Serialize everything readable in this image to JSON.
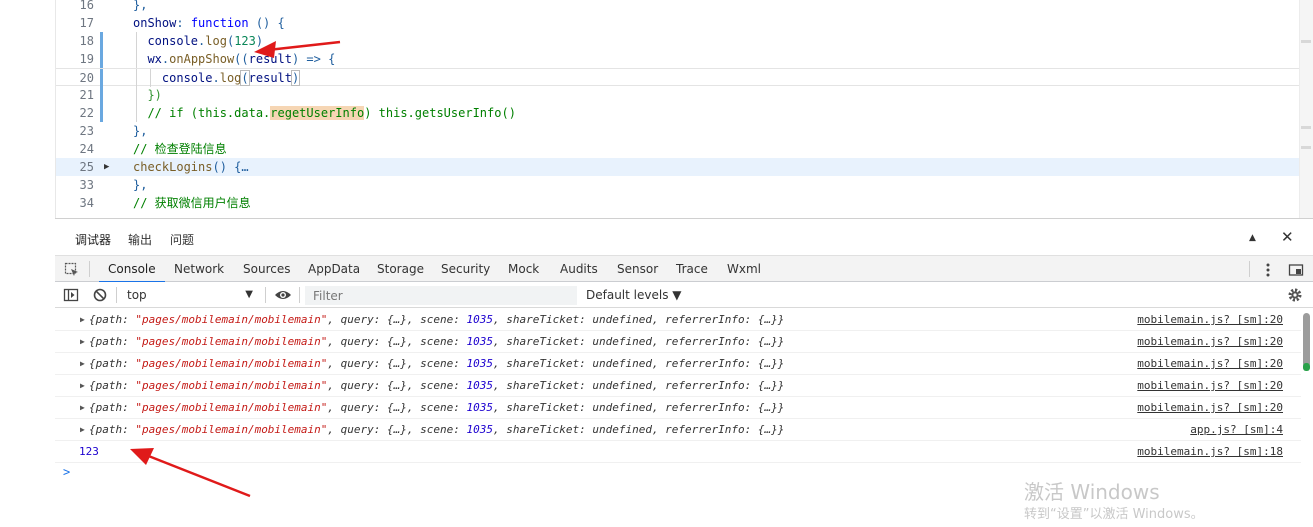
{
  "editor": {
    "lines": [
      {
        "num": "16",
        "tokens": [
          {
            "t": "},",
            "c": "c-plain"
          }
        ]
      },
      {
        "num": "17",
        "tokens": [
          {
            "t": "onShow",
            "c": "c-var"
          },
          {
            "t": ": ",
            "c": "c-plain"
          },
          {
            "t": "function",
            "c": "c-kw"
          },
          {
            "t": " () {",
            "c": "c-plain"
          }
        ]
      },
      {
        "num": "18",
        "tokens": [
          {
            "t": "  console",
            "c": "c-var"
          },
          {
            "t": ".",
            "c": "c-plain"
          },
          {
            "t": "log",
            "c": "c-fn"
          },
          {
            "t": "(",
            "c": "c-plain"
          },
          {
            "t": "123",
            "c": "c-num"
          },
          {
            "t": ")",
            "c": "c-plain"
          }
        ]
      },
      {
        "num": "19",
        "tokens": [
          {
            "t": "  wx",
            "c": "c-var"
          },
          {
            "t": ".",
            "c": "c-plain"
          },
          {
            "t": "onAppShow",
            "c": "c-fn"
          },
          {
            "t": "((",
            "c": "c-plain"
          },
          {
            "t": "result",
            "c": "c-var"
          },
          {
            "t": ") => {",
            "c": "c-plain"
          }
        ]
      },
      {
        "num": "20",
        "tokens": [
          {
            "t": "    console",
            "c": "c-var"
          },
          {
            "t": ".",
            "c": "c-plain"
          },
          {
            "t": "log",
            "c": "c-fn"
          },
          {
            "t": "(",
            "c": "c-plain c-box"
          },
          {
            "t": "result",
            "c": "c-var"
          },
          {
            "t": ")",
            "c": "c-plain c-box"
          }
        ]
      },
      {
        "num": "21",
        "tokens": [
          {
            "t": "  })",
            "c": "c-brk2"
          }
        ]
      },
      {
        "num": "22",
        "tokens": [
          {
            "t": "  // if (this.data.",
            "c": "c-cmt"
          },
          {
            "t": "regetUserInfo",
            "c": "c-cmt c-hl"
          },
          {
            "t": ") this.getsUserInfo()",
            "c": "c-cmt"
          }
        ]
      },
      {
        "num": "23",
        "tokens": [
          {
            "t": "},",
            "c": "c-plain"
          }
        ]
      },
      {
        "num": "24",
        "tokens": [
          {
            "t": "// 检查登陆信息",
            "c": "c-cmt"
          }
        ]
      },
      {
        "num": "25",
        "tokens": [
          {
            "t": "checkLogins",
            "c": "c-fn"
          },
          {
            "t": "() {",
            "c": "c-plain"
          },
          {
            "t": "…",
            "c": "c-plain"
          }
        ]
      },
      {
        "num": "33",
        "tokens": [
          {
            "t": "},",
            "c": "c-plain"
          }
        ]
      },
      {
        "num": "34",
        "tokens": [
          {
            "t": "// 获取微信用户信息",
            "c": "c-cmt"
          }
        ]
      }
    ]
  },
  "panel": {
    "tabs": [
      "调试器",
      "输出",
      "问题"
    ],
    "active_tab": "调试器"
  },
  "devtools": {
    "tabs": [
      "Console",
      "Network",
      "Sources",
      "AppData",
      "Storage",
      "Security",
      "Mock",
      "Audits",
      "Sensor",
      "Trace",
      "Wxml"
    ],
    "active_tab": "Console",
    "context": "top",
    "filter_placeholder": "Filter",
    "levels": "Default levels ▼"
  },
  "console": {
    "rows": [
      {
        "path": "\"pages/mobilemain/mobilemain\"",
        "source": "mobilemain.js? [sm]:20"
      },
      {
        "path": "\"pages/mobilemain/mobilemain\"",
        "source": "mobilemain.js? [sm]:20"
      },
      {
        "path": "\"pages/mobilemain/mobilemain\"",
        "source": "mobilemain.js? [sm]:20"
      },
      {
        "path": "\"pages/mobilemain/mobilemain\"",
        "source": "mobilemain.js? [sm]:20"
      },
      {
        "path": "\"pages/mobilemain/mobilemain\"",
        "source": "mobilemain.js? [sm]:20"
      },
      {
        "path": "\"pages/mobilemain/mobilemain\"",
        "source": "app.js? [sm]:4"
      }
    ],
    "obj_prefix": "{path: ",
    "obj_query": ", query: {…}, scene: ",
    "obj_scene": "1035",
    "obj_rest": ", shareTicket: undefined, referrerInfo: {…}}",
    "number_row": {
      "value": "123",
      "source": "mobilemain.js? [sm]:18"
    },
    "prompt": ">"
  },
  "watermark": {
    "title": "激活 Windows",
    "subtitle": "转到“设置”以激活 Windows。"
  }
}
